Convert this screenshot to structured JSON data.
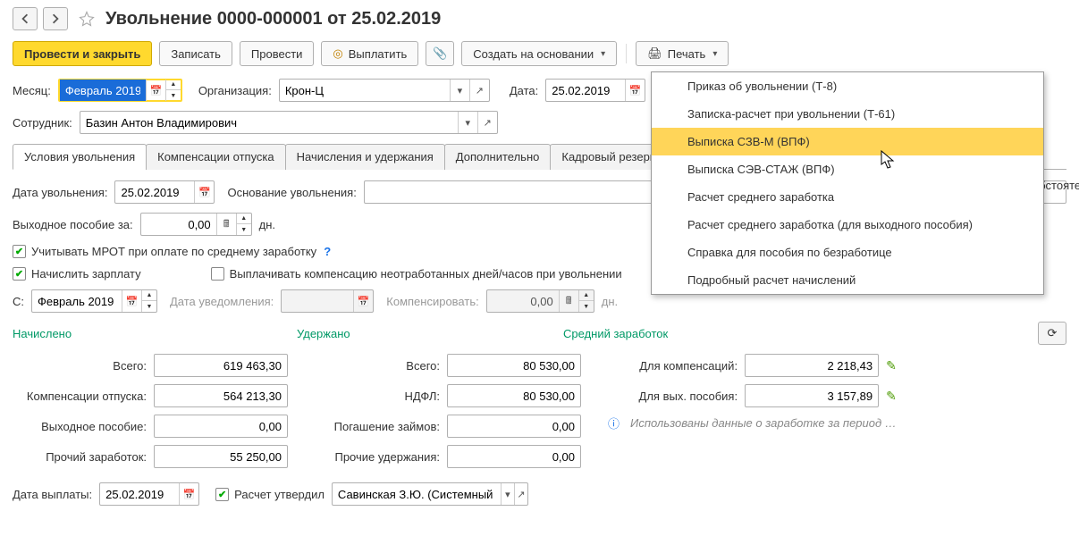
{
  "header": {
    "title": "Увольнение 0000-000001 от 25.02.2019"
  },
  "toolbar": {
    "post_close": "Провести и закрыть",
    "save": "Записать",
    "post": "Провести",
    "pay": "Выплатить",
    "create_from": "Создать на основании",
    "print": "Печать"
  },
  "meta": {
    "month_lbl": "Месяц:",
    "month": "Февраль 2019",
    "org_lbl": "Организация:",
    "org": "Крон-Ц",
    "date_lbl": "Дата:",
    "date": "25.02.2019",
    "emp_lbl": "Сотрудник:",
    "emp": "Базин Антон Владимирович"
  },
  "tabs": [
    "Условия увольнения",
    "Компенсации отпуска",
    "Начисления и удержания",
    "Дополнительно",
    "Кадровый резерв"
  ],
  "cond": {
    "fire_date_lbl": "Дата увольнения:",
    "fire_date": "25.02.2019",
    "basis_lbl": "Основание увольнения:",
    "allowance_lbl": "Выходное пособие за:",
    "allowance": "0,00",
    "days": "дн.",
    "chk_mrot": "Учитывать МРОТ при оплате по среднему заработку",
    "chk_salary": "Начислить зарплату",
    "chk_compensate": "Выплачивать компенсацию неотработанных дней/часов при увольнении",
    "from_lbl": "С:",
    "from": "Февраль 2019",
    "notice_lbl": "Дата уведомления:",
    "comp_lbl": "Компенсировать:",
    "comp": "0,00"
  },
  "sections": {
    "accrued": "Начислено",
    "withheld": "Удержано",
    "avg": "Средний заработок"
  },
  "accrued": {
    "total_lbl": "Всего:",
    "total": "619 463,30",
    "vac_lbl": "Компенсации отпуска:",
    "vac": "564 213,30",
    "sev_lbl": "Выходное пособие:",
    "sev": "0,00",
    "other_lbl": "Прочий заработок:",
    "other": "55 250,00"
  },
  "withheld": {
    "total_lbl": "Всего:",
    "total": "80 530,00",
    "ndfl_lbl": "НДФЛ:",
    "ndfl": "80 530,00",
    "loan_lbl": "Погашение займов:",
    "loan": "0,00",
    "other_lbl": "Прочие удержания:",
    "other": "0,00"
  },
  "avg": {
    "comp_lbl": "Для компенсаций:",
    "comp": "2 218,43",
    "sev_lbl": "Для вых. пособия:",
    "sev": "3 157,89",
    "hint": "Использованы данные о заработке за период …"
  },
  "footer": {
    "paydate_lbl": "Дата выплаты:",
    "paydate": "25.02.2019",
    "approved_lbl": "Расчет утвердил",
    "approved": "Савинская З.Ю. (Системный п"
  },
  "print_menu": [
    "Приказ об увольнении (Т-8)",
    "Записка-расчет при увольнении (Т-61)",
    "Выписка СЗВ-М (ВПФ)",
    "Выписка СЭВ-СТАЖ (ВПФ)",
    "Расчет среднего заработка",
    "Расчет среднего заработка (для выходного пособия)",
    "Справка для пособия по безработице",
    "Подробный расчет начислений"
  ],
  "overflow": "обстоятел"
}
